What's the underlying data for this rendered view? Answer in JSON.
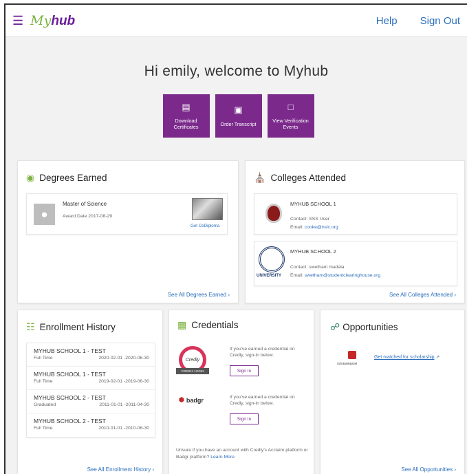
{
  "header": {
    "logo_my": "My",
    "logo_hub": "hub",
    "help": "Help",
    "sign_out": "Sign Out"
  },
  "welcome": "Hi emily, welcome to Myhub",
  "actions": [
    {
      "label": "Download Certificates",
      "icon": "certificate-icon"
    },
    {
      "label": "Order Transcript",
      "icon": "transcript-icon"
    },
    {
      "label": "View Verification Events",
      "icon": "verification-icon"
    }
  ],
  "degrees": {
    "title": "Degrees Earned",
    "item": {
      "name": "Master of Science",
      "award": "Award Date 2017-08-29",
      "link": "Get CeDiploma"
    },
    "see_all": "See All Degrees Earned ›"
  },
  "colleges": {
    "title": "Colleges Attended",
    "items": [
      {
        "name": "MYHUB SCHOOL 1",
        "contact_label": "Contact:",
        "contact": "SSS User",
        "email_label": "Email:",
        "email": "cooke@nslc.org"
      },
      {
        "name": "MYHUB SCHOOL 2",
        "contact_label": "Contact:",
        "contact": "swetham madala",
        "email_label": "Email:",
        "email": "swetham@studentclearinghouse.org",
        "seal_text": "UNIVERSITY"
      }
    ],
    "see_all": "See All Colleges Attended ›"
  },
  "enrollment": {
    "title": "Enrollment History",
    "rows": [
      {
        "name": "MYHUB SCHOOL 1 - TEST",
        "status": "Full Time",
        "dates": "2020-02-01 -2020-06-30"
      },
      {
        "name": "MYHUB SCHOOL 1 - TEST",
        "status": "Full Time",
        "dates": "2019-02-01 -2019-06-30"
      },
      {
        "name": "MYHUB SCHOOL 2 - TEST",
        "status": "Graduated",
        "dates": "2011-01-01 -2011-04-30"
      },
      {
        "name": "MYHUB SCHOOL 2 - TEST",
        "status": "Full Time",
        "dates": "2010-01-01 -2010-06-30"
      }
    ],
    "see_all": "See All Enrollment History ›"
  },
  "credentials": {
    "title": "Credentials",
    "credly": {
      "logo": "Credly",
      "banner": "CREDLY LOGIN",
      "text": "If you've earned a credential on Credly, sign-in below.",
      "button": "Sign In"
    },
    "badgr": {
      "logo": "badgr",
      "text": "If you've earned a credential on Credly, sign-in below.",
      "button": "Sign In"
    },
    "footer": "Unsure if you have an account with Credly's Acclaim platform or Badgr platform?",
    "learn_more": "Learn More"
  },
  "opportunities": {
    "title": "Opportunities",
    "item": {
      "logo": "ScholarshipOwl",
      "link": "Get matched for scholarship"
    },
    "see_all": "See All Opportunities ›"
  },
  "colors": {
    "purple": "#7b2a8c",
    "green": "#7cb342",
    "link": "#2a6ebb"
  }
}
